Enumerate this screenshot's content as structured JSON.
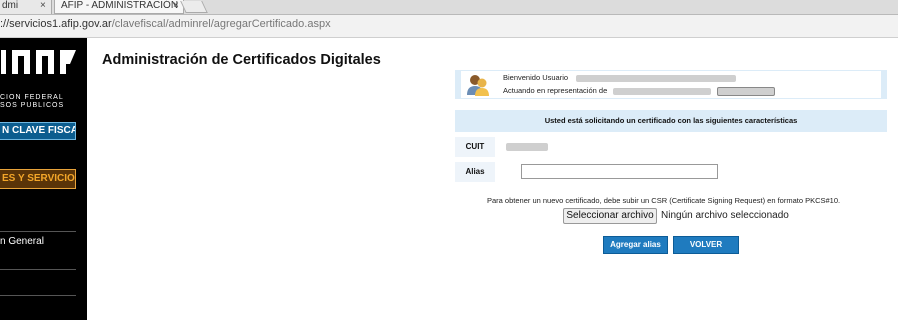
{
  "browser": {
    "tabs": [
      {
        "label": "dmi",
        "close": "×"
      },
      {
        "label": "AFIP - ADMINISTRACIÓN",
        "close": "×"
      }
    ],
    "url_host": "://servicios1.afip.gov.ar",
    "url_path": "/clavefiscal/adminrel/agregarCertificado.aspx"
  },
  "sidebar": {
    "logo_line1": "CION FEDERAL",
    "logo_line2": "SOS PUBLICOS",
    "clave_fiscal_button": "N CLAVE FISCAL",
    "servicios_button": "ES Y SERVICIOS",
    "links": [
      {
        "label": "n General"
      }
    ]
  },
  "main": {
    "title": "Administración de Certificados Digitales",
    "welcome": {
      "greeting": "Bienvenido Usuario",
      "acting_as": "Actuando en representación de"
    },
    "info_header": "Usted está solicitando un certificado con las siguientes características",
    "cuit_label": "CUIT",
    "alias_label": "Alias",
    "alias_value": "",
    "instructions": "Para obtener un nuevo certificado, debe subir un CSR (Certificate Signing Request) en formato PKCS#10.",
    "file_button": "Seleccionar archivo",
    "file_status": "Ningún archivo seleccionado",
    "add_alias_button": "Agregar alias",
    "back_button": "VOLVER"
  },
  "colors": {
    "header_bg": "#dcecf8",
    "primary_button": "#1f7bbf",
    "sidebar_bg": "#000000",
    "clave_fiscal_bg": "#0b5d8f",
    "servicios_text": "#f3a629"
  }
}
